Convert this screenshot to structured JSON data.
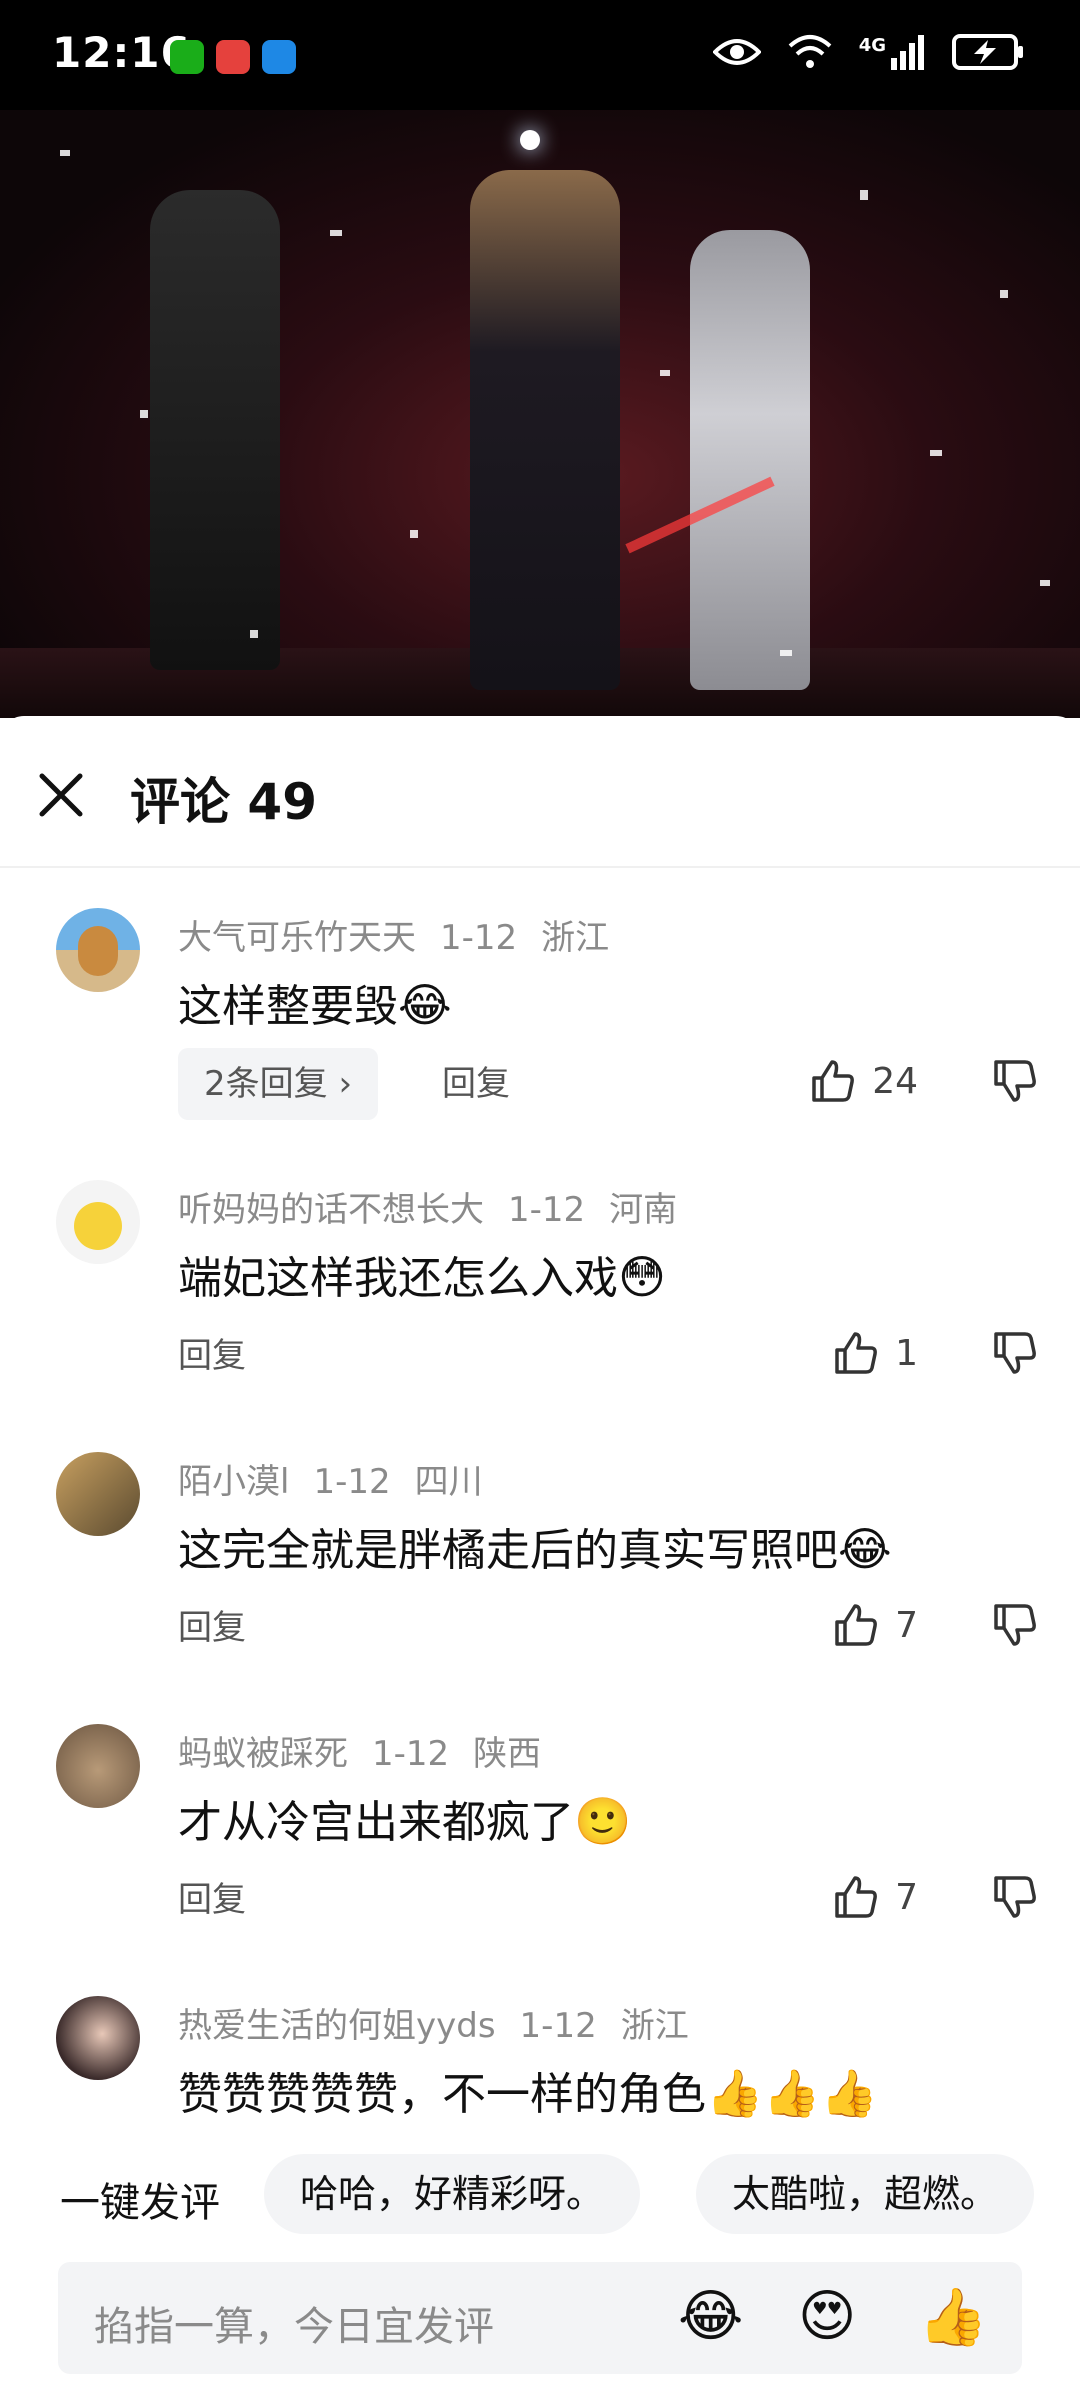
{
  "status_bar": {
    "time": "12:16",
    "network": "4G"
  },
  "sheet": {
    "title": "评论 49"
  },
  "comments": [
    {
      "user": "大气可乐竹天天",
      "date": "1-12",
      "region": "浙江",
      "text": "这样整要毁",
      "emoji": "😂",
      "replies": "2条回复 ›",
      "reply": "回复",
      "likes": "24"
    },
    {
      "user": "听妈妈的话不想长大",
      "date": "1-12",
      "region": "河南",
      "text": "端妃这样我还怎么入戏",
      "emoji": "😳",
      "reply": "回复",
      "likes": "1"
    },
    {
      "user": "陌小漠l",
      "date": "1-12",
      "region": "四川",
      "text": "这完全就是胖橘走后的真实写照吧",
      "emoji": "😂",
      "reply": "回复",
      "likes": "7"
    },
    {
      "user": "蚂蚁被踩死",
      "date": "1-12",
      "region": "陕西",
      "text": "才从冷宫出来都疯了",
      "emoji": "🙂",
      "reply": "回复",
      "likes": "7"
    },
    {
      "user": "热爱生活的何姐yyds",
      "date": "1-12",
      "region": "浙江",
      "text": "赞赞赞赞赞，不一样的角色",
      "emoji": "👍👍👍"
    }
  ],
  "quick_comment": {
    "label": "一键发评",
    "chips": [
      "哈哈，好精彩呀。",
      "太酷啦，超燃。"
    ]
  },
  "input": {
    "placeholder": "掐指一算，今日宜发评",
    "emojis": [
      "😂",
      "😍",
      "👍"
    ]
  }
}
